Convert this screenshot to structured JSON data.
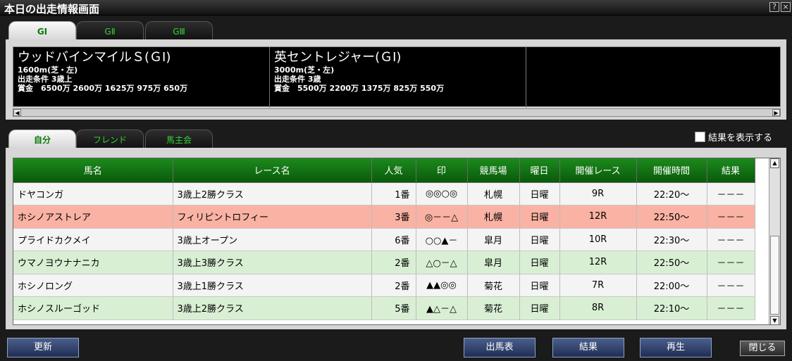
{
  "window": {
    "title": "本日の出走情報画面",
    "help_label": "?",
    "close_label": "×"
  },
  "grade_tabs": [
    {
      "label": "GⅠ",
      "active": true
    },
    {
      "label": "GⅡ",
      "active": false
    },
    {
      "label": "GⅢ",
      "active": false
    }
  ],
  "races": [
    {
      "name": "ウッドバインマイルＳ(ＧⅠ)",
      "distance": "1600m(芝・左)",
      "condition": "出走条件 3歳上",
      "prize": "賞金　6500万 2600万 1625万 975万 650万"
    },
    {
      "name": "英セントレジャー(ＧⅠ)",
      "distance": "3000m(芝・左)",
      "condition": "出走条件 3歳",
      "prize": "賞金　5500万 2200万 1375万 825万 550万"
    }
  ],
  "scroll": {
    "left": "◀",
    "right": "▶",
    "up": "▲",
    "down": "▼"
  },
  "list_tabs": [
    {
      "label": "自分",
      "active": true
    },
    {
      "label": "フレンド",
      "active": false
    },
    {
      "label": "馬主会",
      "active": false
    }
  ],
  "show_results_label": "結果を表示する",
  "table": {
    "headers": [
      "馬名",
      "レース名",
      "人気",
      "印",
      "競馬場",
      "曜日",
      "開催レース",
      "開催時間",
      "結果"
    ],
    "rows": [
      {
        "style": "white",
        "cells": [
          "ドヤコンガ",
          "3歳上2勝クラス",
          "1番",
          "◎◎○◎",
          "札幌",
          "日曜",
          "9R",
          "22:20～",
          "－－－"
        ]
      },
      {
        "style": "pink",
        "cells": [
          "ホシノアストレア",
          "フィリピントロフィー",
          "3番",
          "◎－－△",
          "札幌",
          "日曜",
          "12R",
          "22:50～",
          "－－－"
        ]
      },
      {
        "style": "white",
        "cells": [
          "プライドカクメイ",
          "3歳上オープン",
          "6番",
          "○○▲－",
          "皐月",
          "日曜",
          "10R",
          "22:30～",
          "－－－"
        ]
      },
      {
        "style": "green",
        "cells": [
          "ウマノヨウナナニカ",
          "3歳上3勝クラス",
          "2番",
          "△○－△",
          "皐月",
          "日曜",
          "12R",
          "22:50～",
          "－－－"
        ]
      },
      {
        "style": "white",
        "cells": [
          "ホシノロング",
          "3歳上1勝クラス",
          "2番",
          "▲▲◎◎",
          "菊花",
          "日曜",
          "7R",
          "22:00～",
          "－－－"
        ]
      },
      {
        "style": "green",
        "cells": [
          "ホシノスルーゴッド",
          "3歳上2勝クラス",
          "5番",
          "▲△－△",
          "菊花",
          "日曜",
          "8R",
          "22:10～",
          "－－－"
        ]
      }
    ]
  },
  "buttons": {
    "refresh": "更新",
    "entries": "出馬表",
    "results": "結果",
    "replay": "再生",
    "close": "閉じる"
  }
}
